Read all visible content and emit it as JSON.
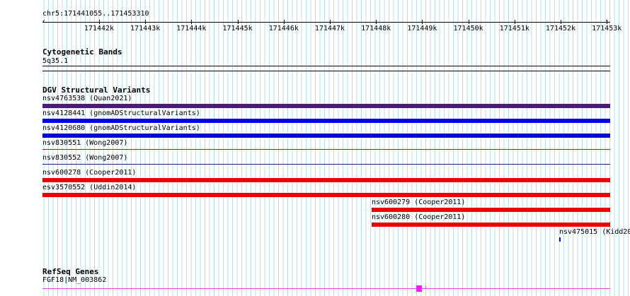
{
  "location": "chr5:171441055..171453310",
  "ruler": {
    "ticks": [
      "171442k",
      "171443k",
      "171444k",
      "171445k",
      "171446k",
      "171447k",
      "171448k",
      "171449k",
      "171450k",
      "171451k",
      "171452k",
      "171453k"
    ]
  },
  "tracks": {
    "cytoband": {
      "title": "Cytogenetic Bands",
      "label": "5q35.1"
    },
    "dgv": {
      "title": "DGV Structural Variants",
      "features": [
        {
          "label": "nsv4763538 (Quan2021)",
          "color": "#4b1a7a"
        },
        {
          "label": "nsv4128441 (gnomADStructuralVariants)",
          "color": "#0000e6"
        },
        {
          "label": "nsv4120680 (gnomADStructuralVariants)",
          "color": "#0000e6"
        },
        {
          "label": "nsv830551 (Wong2007)",
          "color": "#e00000"
        },
        {
          "label": "nsv830552 (Wong2007)",
          "color": "#1a1a8c"
        },
        {
          "label": "nsv600278 (Cooper2011)",
          "color": "#ee0000"
        },
        {
          "label": "esv3570552 (Uddin2014)",
          "color": "#ee0000"
        },
        {
          "label": "nsv600279 (Cooper2011)",
          "color": "#ee0000"
        },
        {
          "label": "nsv600280 (Cooper2011)",
          "color": "#ee0000"
        },
        {
          "label": "nsv475015 (Kidd20",
          "color": "#0000e6"
        }
      ]
    },
    "refseq": {
      "title": "RefSeq Genes",
      "label": "FGF18|NM_003862",
      "color": "#e040e0"
    }
  }
}
